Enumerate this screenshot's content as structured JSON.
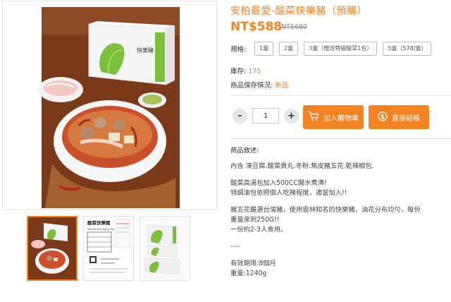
{
  "product": {
    "title": "安柏最愛-酸菜快樂豬（預購）",
    "price": "NT$588",
    "original_price": "NT$680"
  },
  "spec": {
    "label": "規格:",
    "options": [
      "1盒",
      "2盒",
      "3盒（贈送特級酸菜1包）",
      "5盒（578/盒）"
    ]
  },
  "stock": {
    "label": "庫存:",
    "value": "175"
  },
  "condition": {
    "label": "商品保存情況:",
    "value": "新品"
  },
  "quantity": {
    "minus": "-",
    "value": "1",
    "plus": "+"
  },
  "buttons": {
    "add_to_cart": "加入購物車",
    "buy_now": "直接結帳"
  },
  "description": {
    "heading": "商品敘述:",
    "contents": "內含 凍豆腐.酸菜貢丸.冬粉.無皮豬五花.乾辣椒包.",
    "step1": "酸菜高湯包加入500CC開水煮沸!",
    "step2": "特調油包依照個人吃辣程度，適當加入!!",
    "pork1": "豬五花嚴選台灣豬，使用雲林知名的快樂豬，油花分布均勻，每份",
    "pork2": "重量來到250G!!",
    "serving": "一份約2-3人食用。",
    "separator": "----",
    "shelf_life": "有效期限:8個月",
    "weight": "重量:1240g"
  },
  "images": {
    "main_box_label": "快樂豬",
    "thumb2_title": "酸菜快樂豬",
    "thumb2_subtitle": "Sauerkraut Happy Pig"
  },
  "colors": {
    "accent": "#f58220",
    "wood": "#8a4b22",
    "box_green": "#7cbf3a"
  }
}
